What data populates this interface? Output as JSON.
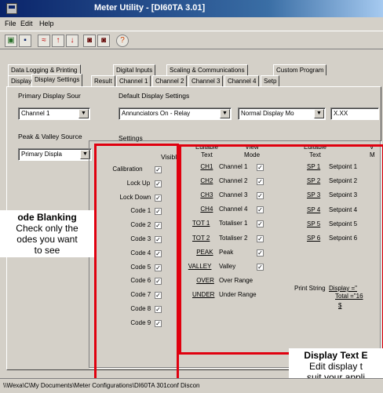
{
  "window": {
    "title": "Meter Utility   - [DI60TA  3.01]"
  },
  "menu": [
    "File",
    "Edit",
    "Help"
  ],
  "tabs": {
    "row1": [
      "Data Logging & Printing",
      "Digital Inputs",
      "Scaling & Communications",
      "Custom Program"
    ],
    "row2": [
      "Display",
      "Display Settings",
      "Result",
      "Channel 1",
      "Channel 2",
      "Channel 3",
      "Channel 4",
      "Setp"
    ]
  },
  "primary_display": {
    "label": "Primary Display Sour",
    "value": "Channel 1"
  },
  "default_display": {
    "label": "Default Display Settings",
    "annunciators": "Annunciators On - Relay",
    "display_mode": "Normal Display Mo",
    "format": "X.XX"
  },
  "peak_valley": {
    "label": "Peak & Valley Source",
    "value": "Primary Displa"
  },
  "settings": {
    "label": "Settings",
    "visible_header": "Visible",
    "visible_items": [
      "Calibration",
      "Lock Up",
      "Lock Down",
      "Code 1",
      "Code 2",
      "Code 3",
      "Code 4",
      "Code 5",
      "Code 6",
      "Code 7",
      "Code 8",
      "Code 9"
    ],
    "editable_header": "Editable\nText",
    "view_mode_header": "View\nMode",
    "channels": [
      {
        "code": "CH1",
        "name": "Channel 1",
        "checked": true
      },
      {
        "code": "CH2",
        "name": "Channel 2",
        "checked": true
      },
      {
        "code": "CH3",
        "name": "Channel 3",
        "checked": true
      },
      {
        "code": "CH4",
        "name": "Channel 4",
        "checked": true
      },
      {
        "code": "TOT 1",
        "name": "Totaliser 1",
        "checked": true
      },
      {
        "code": "TOT 2",
        "name": "Totaliser 2",
        "checked": true
      },
      {
        "code": "PEAK",
        "name": "Peak",
        "checked": true
      },
      {
        "code": "VALLEY",
        "name": "Valley",
        "checked": true
      },
      {
        "code": "OVER",
        "name": "Over Range",
        "checked": false
      },
      {
        "code": "UNDER",
        "name": "Under Range",
        "checked": false
      }
    ],
    "setpoint_header": "Editable\nText",
    "setpoint_header2": "V\nM",
    "setpoints": [
      {
        "code": "SP 1",
        "name": "Setpoint 1"
      },
      {
        "code": "SP 2",
        "name": "Setpoint 2"
      },
      {
        "code": "SP 3",
        "name": "Setpoint 3"
      },
      {
        "code": "SP 4",
        "name": "Setpoint 4"
      },
      {
        "code": "SP 5",
        "name": "Setpoint 5"
      },
      {
        "code": "SP 6",
        "name": "Setpoint 6"
      }
    ],
    "print_string_label": "Print String",
    "print_string_line1": "Display =\"",
    "print_string_line2": "Total =\"16",
    "print_string_line3": "$"
  },
  "callouts": {
    "code_blanking_title": "ode Blanking",
    "code_blanking_l1": "Check only the",
    "code_blanking_l2": "odes you want",
    "code_blanking_l3": "to see",
    "display_text_title": "Display Text E",
    "display_text_l1": "Edit display t",
    "display_text_l2": "suit your appli"
  },
  "status": {
    "path": "\\\\Wexa\\C\\My Documents\\Meter Configurations\\DI60TA 301conf  Discon"
  },
  "colors": {
    "title_bar": "#0a246a",
    "highlight_box": "#e0000f",
    "background": "#d4d0c8"
  }
}
